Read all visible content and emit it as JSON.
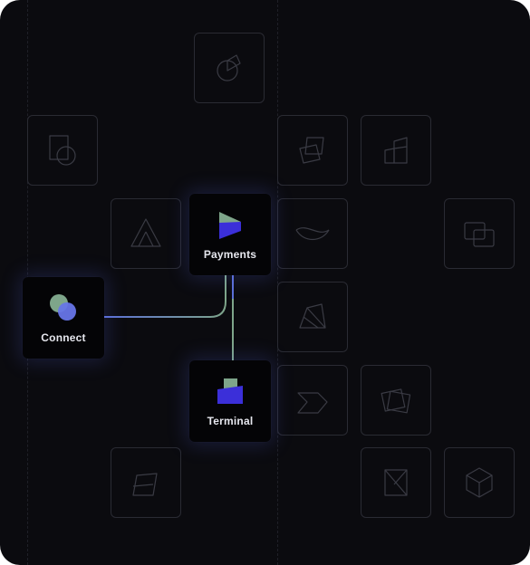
{
  "products": {
    "payments": {
      "label": "Payments",
      "icon": "payments-icon"
    },
    "connect": {
      "label": "Connect",
      "icon": "connect-icon"
    },
    "terminal": {
      "label": "Terminal",
      "icon": "terminal-icon"
    }
  },
  "colors": {
    "background": "#0b0b0f",
    "tile_border": "#2a2b33",
    "wire_green": "#7ea58a",
    "wire_blue": "#5b6fd6",
    "accent_indigo": "#3b2fd9"
  }
}
